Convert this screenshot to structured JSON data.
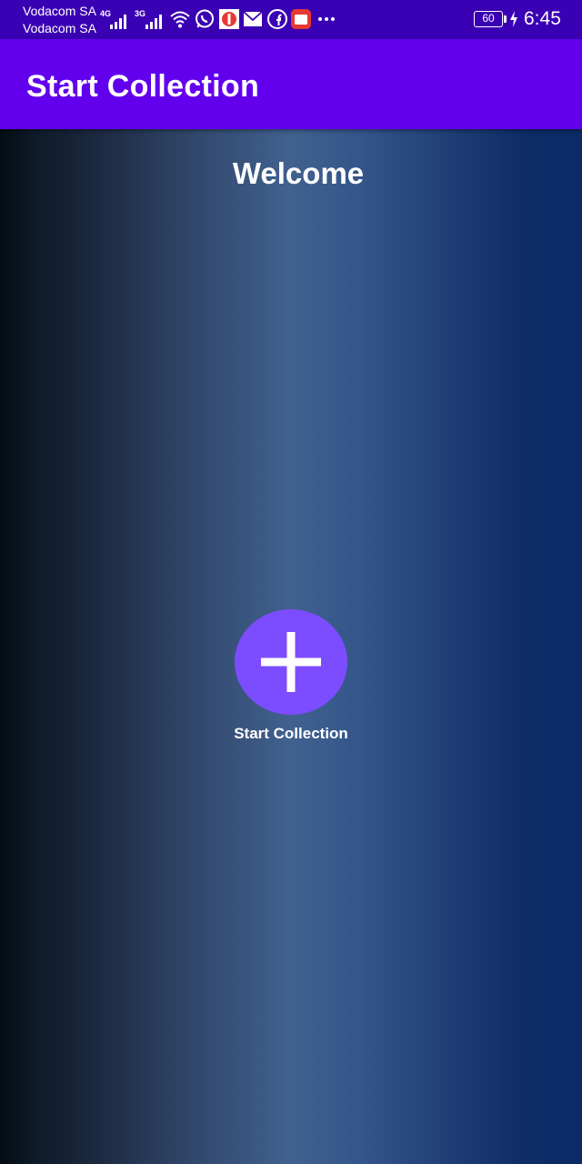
{
  "status_bar": {
    "carriers": [
      "Vodacom SA",
      "Vodacom SA"
    ],
    "network_labels": [
      "4G",
      "3G"
    ],
    "battery": "60",
    "time": "6:45",
    "icons": [
      "signal-icon",
      "signal-icon",
      "wifi-icon",
      "whatsapp-icon",
      "app-notification-icon",
      "mail-icon",
      "facebook-icon",
      "tv-app-icon",
      "more-icon",
      "battery-icon",
      "charging-icon"
    ]
  },
  "app_bar": {
    "title": "Start Collection"
  },
  "main": {
    "welcome": "Welcome",
    "add_button_icon": "plus-icon",
    "add_button_label": "Start Collection"
  },
  "colors": {
    "status_bar": "#3a00b3",
    "app_bar": "#6200ee",
    "fab": "#7c4dff"
  }
}
